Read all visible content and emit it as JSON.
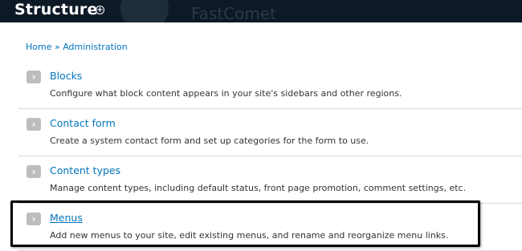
{
  "header": {
    "title": "Structure",
    "watermark": "FastComet"
  },
  "breadcrumb": {
    "items": [
      "Home",
      "Administration"
    ],
    "separator": "»"
  },
  "items": [
    {
      "label": "Blocks",
      "description": "Configure what block content appears in your site's sidebars and other regions."
    },
    {
      "label": "Contact form",
      "description": "Create a system contact form and set up categories for the form to use."
    },
    {
      "label": "Content types",
      "description": "Manage content types, including default status, front page promotion, comment settings, etc."
    },
    {
      "label": "Menus",
      "description": "Add new menus to your site, edit existing menus, and rename and reorganize menu links."
    }
  ],
  "colors": {
    "header_bg": "#0d1a26",
    "link": "#0074bd",
    "highlight_border": "#000000"
  }
}
